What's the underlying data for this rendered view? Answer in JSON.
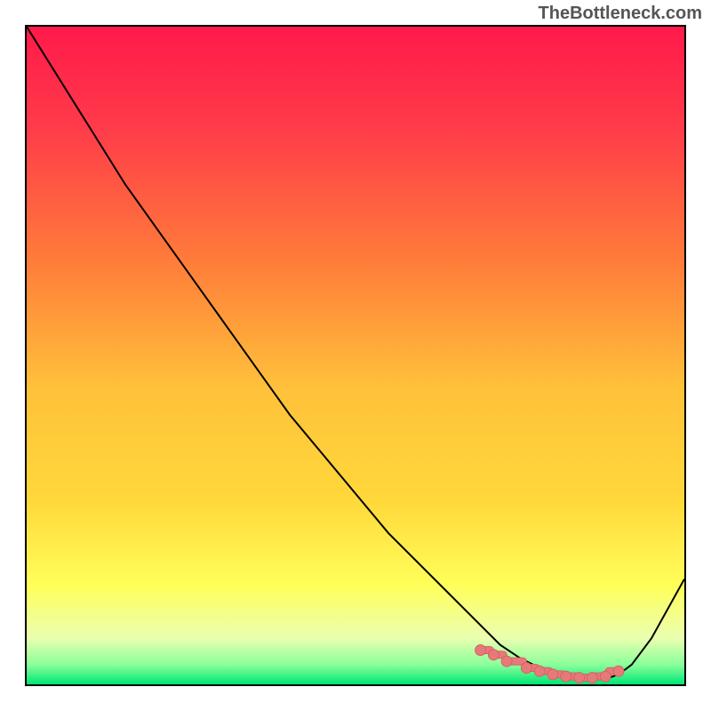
{
  "watermark": "TheBottleneck.com",
  "chart_data": {
    "type": "line",
    "title": "",
    "xlabel": "",
    "ylabel": "",
    "xlim": [
      0,
      100
    ],
    "ylim": [
      0,
      100
    ],
    "gradient_colors": {
      "top": "#ff1a4a",
      "mid_upper": "#ff7a3a",
      "mid": "#ffd83a",
      "mid_lower": "#ffff5a",
      "bottom": "#00e676"
    },
    "curve": {
      "x": [
        0,
        5,
        10,
        15,
        20,
        25,
        30,
        35,
        40,
        45,
        50,
        55,
        60,
        65,
        70,
        72,
        75,
        78,
        80,
        82,
        85,
        88,
        90,
        92,
        95,
        100
      ],
      "y": [
        100,
        92,
        84,
        76,
        69,
        62,
        55,
        48,
        41,
        35,
        29,
        23,
        18,
        13,
        8,
        6,
        4,
        2.5,
        1.5,
        1,
        0.8,
        0.8,
        1.5,
        3,
        7,
        16
      ]
    },
    "markers": {
      "x": [
        69,
        71,
        73,
        76,
        78,
        80,
        82,
        84,
        86,
        88,
        90
      ],
      "y": [
        5.2,
        4.5,
        3.5,
        2.5,
        2.0,
        1.5,
        1.2,
        1.0,
        1.0,
        1.2,
        2.0
      ]
    },
    "marker_color": "#e67a7a"
  }
}
